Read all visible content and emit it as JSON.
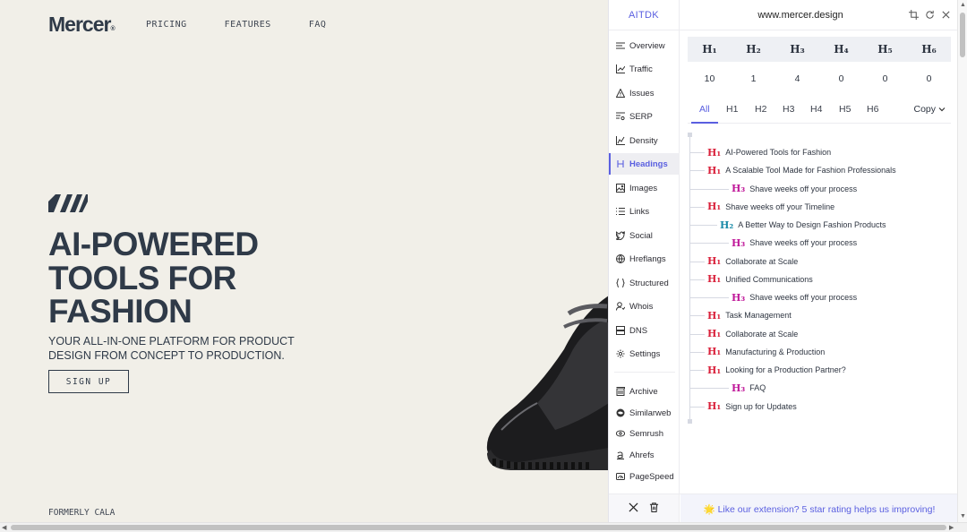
{
  "site": {
    "logo": "Mercer",
    "logo_mark": "®",
    "nav": [
      "PRICING",
      "FEATURES",
      "FAQ"
    ],
    "hero_title": "AI-POWERED TOOLS FOR FASHION",
    "hero_subtitle": "YOUR ALL-IN-ONE PLATFORM FOR PRODUCT DESIGN FROM CONCEPT TO PRODUCTION.",
    "signup_label": "SIGN UP",
    "formerly": "FORMERLY CALA"
  },
  "panel": {
    "brand": "AITDK",
    "domain": "www.mercer.design",
    "header_icons": [
      "crop-icon",
      "refresh-icon",
      "close-icon"
    ],
    "sidebar": [
      {
        "label": "Overview",
        "icon": "overview-icon"
      },
      {
        "label": "Traffic",
        "icon": "chart-line-icon"
      },
      {
        "label": "Issues",
        "icon": "warning-icon"
      },
      {
        "label": "SERP",
        "icon": "serp-icon"
      },
      {
        "label": "Density",
        "icon": "density-icon"
      },
      {
        "label": "Headings",
        "icon": "heading-icon",
        "active": true
      },
      {
        "label": "Images",
        "icon": "image-icon"
      },
      {
        "label": "Links",
        "icon": "list-icon"
      },
      {
        "label": "Social",
        "icon": "twitter-icon"
      },
      {
        "label": "Hreflangs",
        "icon": "globe-icon"
      },
      {
        "label": "Structured",
        "icon": "braces-icon"
      },
      {
        "label": "Whois",
        "icon": "user-icon"
      },
      {
        "label": "DNS",
        "icon": "server-icon"
      },
      {
        "label": "Settings",
        "icon": "gear-icon"
      },
      {
        "label": "Archive",
        "icon": "archive-icon"
      },
      {
        "label": "Similarweb",
        "icon": "similarweb-icon"
      },
      {
        "label": "Semrush",
        "icon": "semrush-icon"
      },
      {
        "label": "Ahrefs",
        "icon": "ahrefs-icon"
      },
      {
        "label": "PageSpeed",
        "icon": "speed-icon"
      }
    ],
    "counts": {
      "headers": [
        "H1",
        "H2",
        "H3",
        "H4",
        "H5",
        "H6"
      ],
      "values": [
        "10",
        "1",
        "4",
        "0",
        "0",
        "0"
      ]
    },
    "tabs": [
      "All",
      "H1",
      "H2",
      "H3",
      "H4",
      "H5",
      "H6"
    ],
    "active_tab": "All",
    "copy_label": "Copy",
    "headings": [
      {
        "level": "H1",
        "text": "AI-Powered Tools for Fashion"
      },
      {
        "level": "H1",
        "text": "A Scalable Tool Made for Fashion Professionals"
      },
      {
        "level": "H3",
        "text": "Shave weeks off your process"
      },
      {
        "level": "H1",
        "text": "Shave weeks off your Timeline"
      },
      {
        "level": "H2",
        "text": "A Better Way to Design Fashion Products"
      },
      {
        "level": "H3",
        "text": "Shave weeks off your process"
      },
      {
        "level": "H1",
        "text": "Collaborate at Scale"
      },
      {
        "level": "H1",
        "text": "Unified Communications"
      },
      {
        "level": "H3",
        "text": "Shave weeks off your process"
      },
      {
        "level": "H1",
        "text": "Task Management"
      },
      {
        "level": "H1",
        "text": "Collaborate at Scale"
      },
      {
        "level": "H1",
        "text": "Manufacturing & Production"
      },
      {
        "level": "H1",
        "text": "Looking for a Production Partner?"
      },
      {
        "level": "H3",
        "text": "FAQ"
      },
      {
        "level": "H1",
        "text": "Sign up for Updates"
      }
    ],
    "footer_icons": [
      "x-twitter-icon",
      "trash-icon"
    ],
    "rating_text": "🌟 Like our extension? 5 star rating helps us improving!"
  },
  "colors": {
    "accent": "#5a5fe0",
    "h1": "#d9213b",
    "h2": "#1a8aa8",
    "h3": "#c0199a",
    "site_bg": "#f1efe8",
    "site_text": "#2f3a48"
  }
}
